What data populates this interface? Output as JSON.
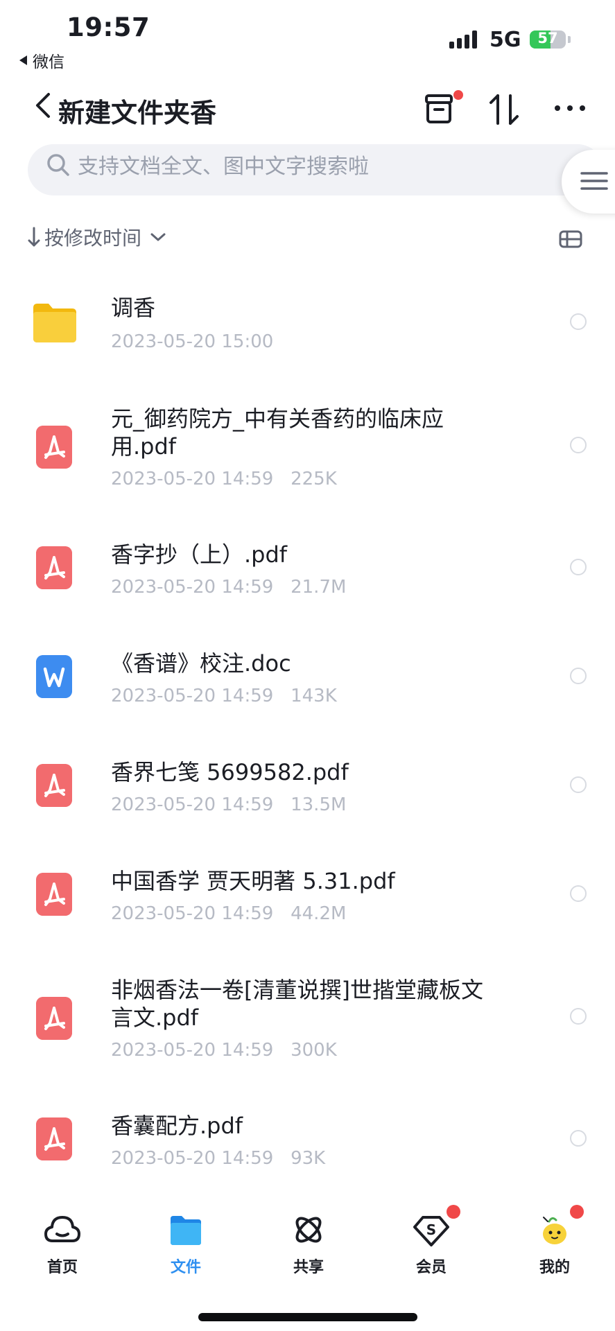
{
  "status_bar": {
    "time": "19:57",
    "back_app": "微信",
    "network": "5G",
    "battery": "57",
    "battery_level": 0.57
  },
  "nav": {
    "title": "新建文件夹香"
  },
  "search": {
    "placeholder": "支持文档全文、图中文字搜索啦"
  },
  "sort": {
    "label": "按修改时间"
  },
  "files": [
    {
      "type": "folder",
      "name": "调香",
      "date": "2023-05-20 15:00",
      "size": ""
    },
    {
      "type": "pdf",
      "name": "元_御药院方_中有关香药的临床应用.pdf",
      "date": "2023-05-20 14:59",
      "size": "225K"
    },
    {
      "type": "pdf",
      "name": "香字抄（上）.pdf",
      "date": "2023-05-20 14:59",
      "size": "21.7M"
    },
    {
      "type": "doc",
      "name": "《香谱》校注.doc",
      "date": "2023-05-20 14:59",
      "size": "143K"
    },
    {
      "type": "pdf",
      "name": "香界七笺 5699582.pdf",
      "date": "2023-05-20 14:59",
      "size": "13.5M"
    },
    {
      "type": "pdf",
      "name": "中国香学 贾天明著 5.31.pdf",
      "date": "2023-05-20 14:59",
      "size": "44.2M"
    },
    {
      "type": "pdf",
      "name": "非烟香法一卷[清董说撰]世揩堂藏板文言文.pdf",
      "date": "2023-05-20 14:59",
      "size": "300K"
    },
    {
      "type": "pdf",
      "name": "香囊配方.pdf",
      "date": "2023-05-20 14:59",
      "size": "93K"
    }
  ],
  "tabs": [
    {
      "label": "首页",
      "icon": "cloud-icon"
    },
    {
      "label": "文件",
      "icon": "folder-icon"
    },
    {
      "label": "共享",
      "icon": "atom-icon"
    },
    {
      "label": "会员",
      "icon": "vip-diamond-icon"
    },
    {
      "label": "我的",
      "icon": "mascot-avatar-icon"
    }
  ],
  "colors": {
    "accent": "#2e8ff0",
    "badge": "#f04848",
    "pdf": "#f26b6e",
    "doc": "#3d8cf0",
    "folder": "#f7c52c"
  }
}
